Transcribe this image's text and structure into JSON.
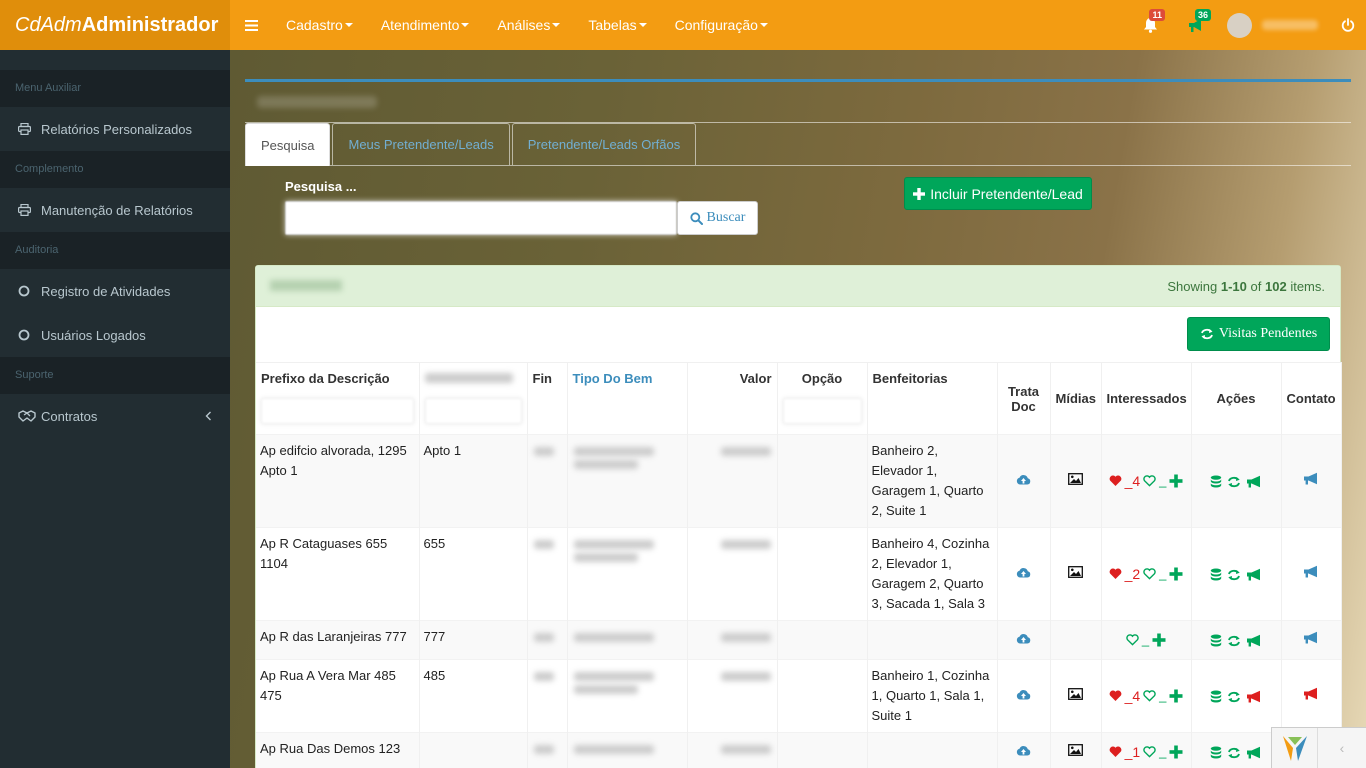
{
  "brand": {
    "light": "CdAdm",
    "bold": "Administrador"
  },
  "nav": {
    "items": [
      {
        "label": "Cadastro"
      },
      {
        "label": "Atendimento"
      },
      {
        "label": "Análises"
      },
      {
        "label": "Tabelas"
      },
      {
        "label": "Configuração"
      }
    ],
    "notifications_count": "11",
    "flags_count": "36"
  },
  "sidebar": {
    "sections": [
      {
        "header": "Menu Auxiliar",
        "items": [
          {
            "label": "Relatórios Personalizados",
            "icon": "print-icon"
          }
        ]
      },
      {
        "header": "Complemento",
        "items": [
          {
            "label": "Manutenção de Relatórios",
            "icon": "print-icon"
          }
        ]
      },
      {
        "header": "Auditoria",
        "items": [
          {
            "label": "Registro de Atividades",
            "icon": "circle-outline-icon"
          },
          {
            "label": "Usuários Logados",
            "icon": "circle-outline-icon"
          }
        ]
      },
      {
        "header": "Suporte",
        "items": [
          {
            "label": "Contratos",
            "icon": "handshake-icon"
          }
        ]
      }
    ]
  },
  "tabs": [
    {
      "label": "Pesquisa",
      "active": true
    },
    {
      "label": "Meus Pretendente/Leads",
      "active": false
    },
    {
      "label": "Pretendente/Leads Orfãos",
      "active": false
    }
  ],
  "search": {
    "label": "Pesquisa ...",
    "value": "",
    "button_label": "Buscar"
  },
  "include_button": "Incluir Pretendente/Lead",
  "summary": {
    "prefix": "Showing",
    "range": "1-10",
    "of": "of",
    "total": "102",
    "suffix": "items."
  },
  "visitas_button": "Visitas Pendentes",
  "table": {
    "headers": {
      "prefixo": "Prefixo da Descrição",
      "fin": "Fin",
      "tipo": "Tipo Do Bem",
      "valor": "Valor",
      "opcao": "Opção",
      "benfeitorias": "Benfeitorias",
      "trata1": "Trata",
      "trata2": "Doc",
      "midias": "Mídias",
      "interessados": "Interessados",
      "acoes": "Ações",
      "contato": "Contato"
    },
    "rows": [
      {
        "prefixo": "Ap edifcio alvorada, 1295 Apto 1",
        "complemento": "Apto 1",
        "benfeitorias": "Banheiro 2, Elevador 1, Garagem 1, Quarto 2, Suite 1",
        "hearts": "_4",
        "has_heart": true,
        "has_media": true,
        "flag_color": "#00a65a",
        "contact_color": "#3c8dbc"
      },
      {
        "prefixo": "Ap R Cataguases 655 1104",
        "complemento": "655",
        "benfeitorias": "Banheiro 4, Cozinha 2, Elevador 1, Garagem 2, Quarto 3, Sacada 1, Sala 3",
        "hearts": "_2",
        "has_heart": true,
        "has_media": true,
        "flag_color": "#00a65a",
        "contact_color": "#3c8dbc"
      },
      {
        "prefixo": "Ap R das Laranjeiras 777",
        "complemento": "777",
        "benfeitorias": "",
        "hearts": "",
        "has_heart": false,
        "has_media": false,
        "flag_color": "#00a65a",
        "contact_color": "#3c8dbc"
      },
      {
        "prefixo": "Ap Rua A Vera Mar 485 475",
        "complemento": "485",
        "benfeitorias": "Banheiro 1, Cozinha 1, Quarto 1, Sala 1, Suite 1",
        "hearts": "_4",
        "has_heart": true,
        "has_media": true,
        "flag_color": "#dd1f1f",
        "contact_color": "#dd1f1f"
      },
      {
        "prefixo": "Ap Rua Das Demos 123",
        "complemento": "",
        "benfeitorias": "",
        "hearts": "_1",
        "has_heart": true,
        "has_media": true,
        "flag_color": "#00a65a",
        "contact_color": "#3c8dbc"
      }
    ]
  },
  "colors": {
    "header": "#f39c12",
    "brand_bg": "#e08e0b",
    "sidebar": "#222d32",
    "success": "#00a65a",
    "primary": "#3c8dbc",
    "danger": "#dd1f1f"
  }
}
